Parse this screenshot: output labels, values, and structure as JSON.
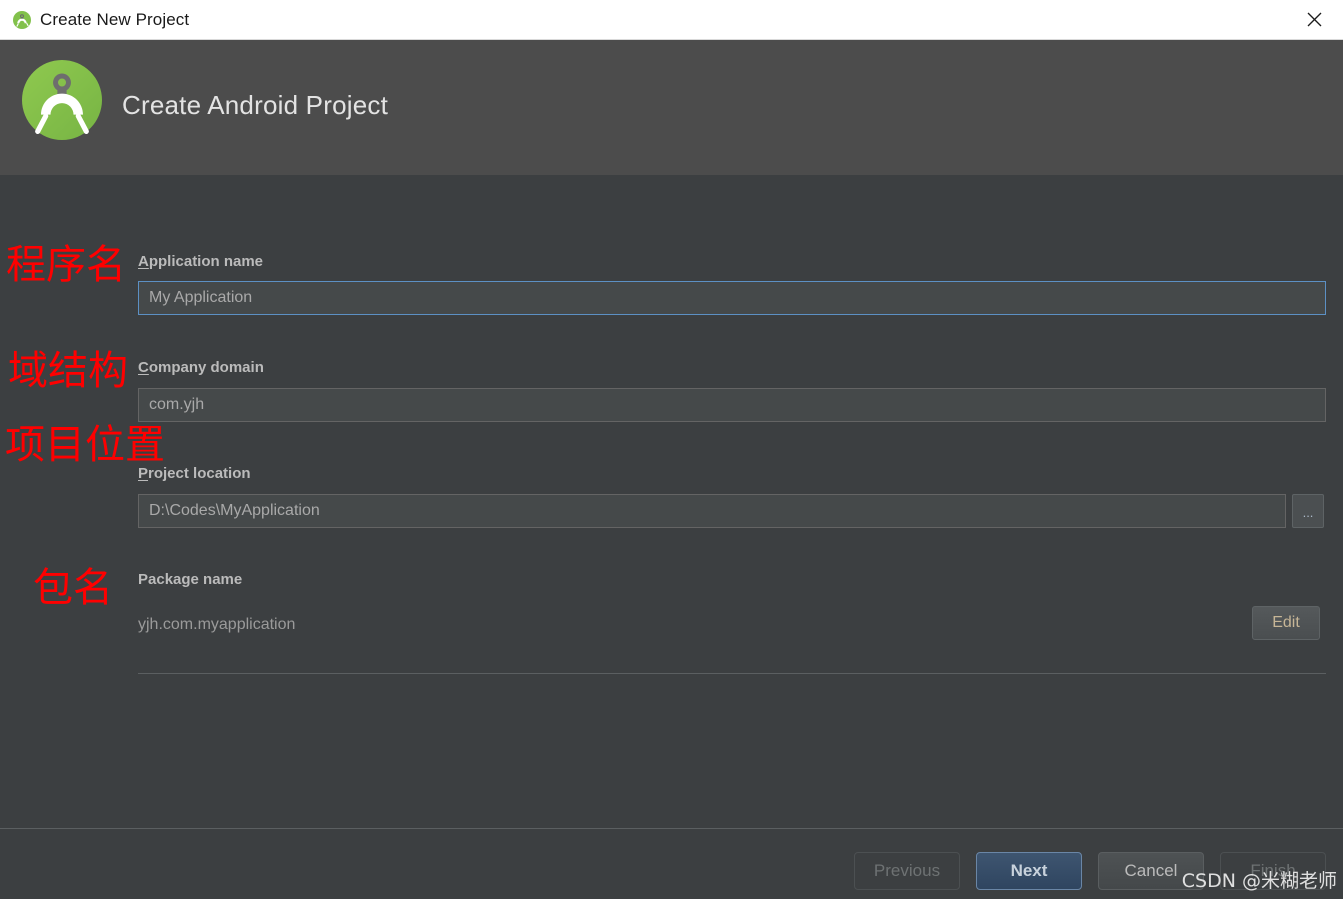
{
  "window": {
    "title": "Create New Project",
    "icon": "android-studio-icon",
    "close_label": "×"
  },
  "banner": {
    "title": "Create Android Project",
    "logo": "android-studio-logo"
  },
  "fields": {
    "application_name": {
      "label_mnemonic": "A",
      "label_rest": "pplication name",
      "value": "My Application",
      "focused": true
    },
    "company_domain": {
      "label_mnemonic": "C",
      "label_rest": "ompany domain",
      "value": "com.yjh",
      "focused": false
    },
    "project_location": {
      "label_mnemonic": "P",
      "label_rest": "roject location",
      "value": "D:\\Codes\\MyApplication",
      "browse_label": "...",
      "focused": false
    },
    "package_name": {
      "label": "Package name",
      "value": "yjh.com.myapplication",
      "edit_label": "Edit"
    }
  },
  "buttons": {
    "previous": "Previous",
    "next": "Next",
    "cancel": "Cancel",
    "finish": "Finish"
  },
  "annotations": [
    {
      "text": "程序名",
      "note": "application name"
    },
    {
      "text": "域结构",
      "note": "company domain"
    },
    {
      "text": "项目位置",
      "note": "project location"
    },
    {
      "text": "包名",
      "note": "package name"
    }
  ],
  "watermark": "CSDN @米糊老师",
  "colors": {
    "titlebar_bg": "#ffffff",
    "banner_bg": "#4c4c4c",
    "dialog_bg": "#3c3f41",
    "field_bg": "#45494a",
    "focus_border": "#5c90c4",
    "default_button_bg": "#365880",
    "annotation": "#ff0000",
    "android_green": "#82c14b"
  }
}
